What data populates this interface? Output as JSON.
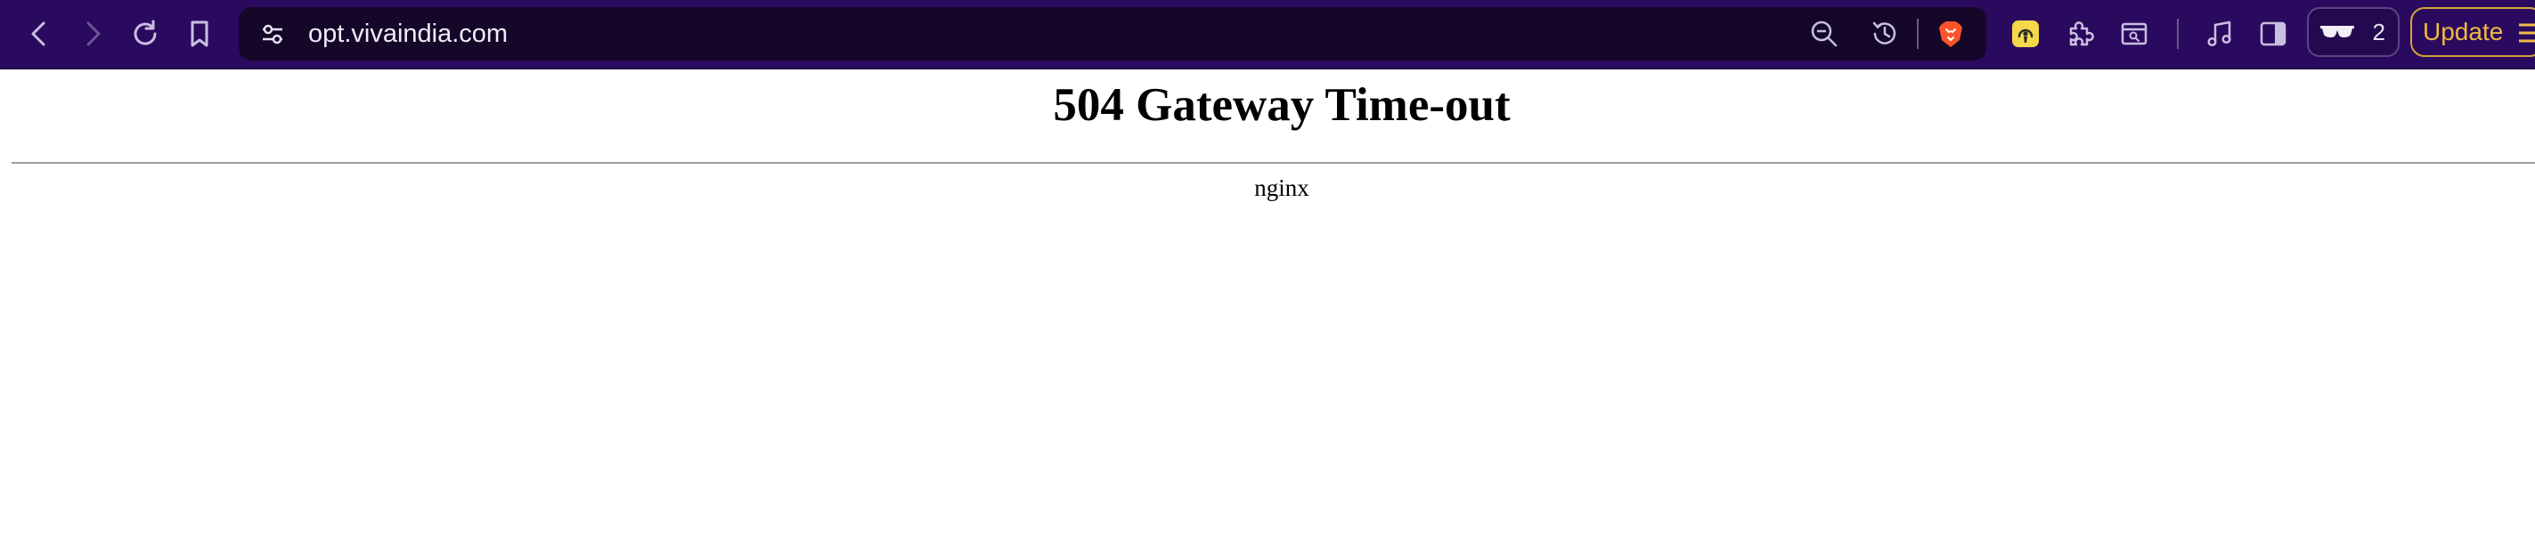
{
  "browser": {
    "url": "opt.vivaindia.com",
    "rewards_count": "2",
    "update_label": "Update",
    "icons": [
      "back-icon",
      "forward-icon",
      "reload-icon",
      "bookmark-icon",
      "site-settings-icon",
      "zoom-out-icon",
      "history-icon",
      "brave-shields-icon",
      "extension-audio-icon",
      "extensions-icon",
      "tab-search-icon",
      "media-controls-icon",
      "sidebar-icon",
      "private-glasses-icon",
      "menu-icon"
    ],
    "colors": {
      "toolbar": "#2a0a5e",
      "urlbar": "#150728",
      "update_accent": "#efb943",
      "brave_orange": "#fb542b"
    }
  },
  "page": {
    "title": "504 Gateway Time-out",
    "server": "nginx"
  }
}
